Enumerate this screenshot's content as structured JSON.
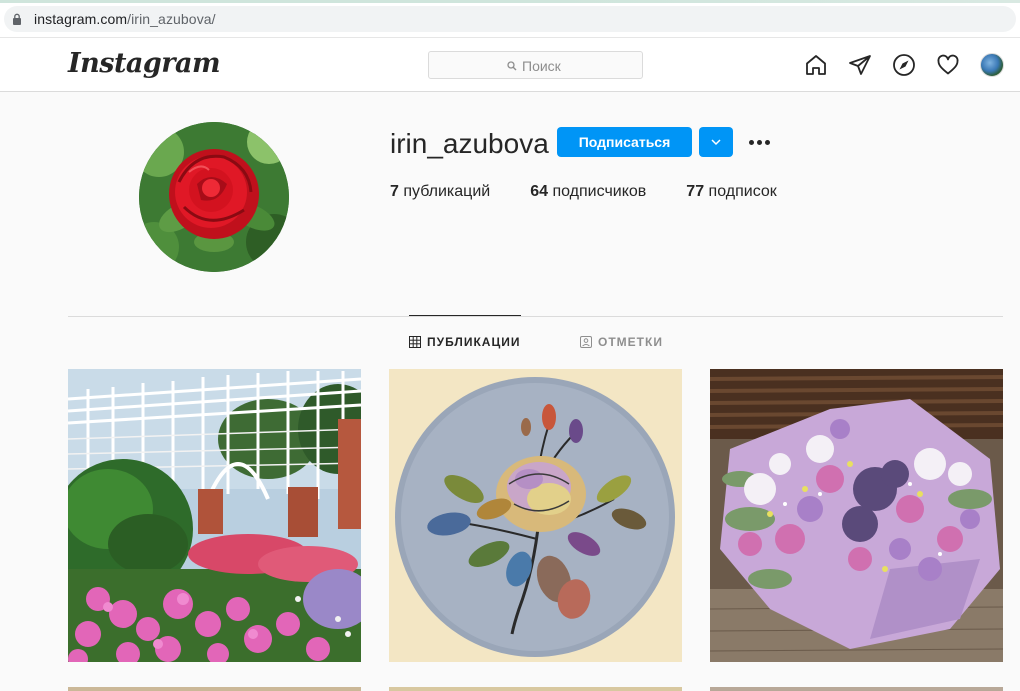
{
  "browser": {
    "url_host": "instagram.com",
    "url_path": "/irin_azubova/"
  },
  "nav": {
    "logo": "Instagram",
    "search_placeholder": "Поиск",
    "icons": [
      "home-icon",
      "direct-icon",
      "explore-icon",
      "activity-heart-icon",
      "profile-avatar"
    ]
  },
  "profile": {
    "username": "irin_azubova",
    "follow_label": "Подписаться",
    "stats": {
      "posts_count": "7",
      "posts_label": "публикаций",
      "followers_count": "64",
      "followers_label": "подписчиков",
      "following_count": "77",
      "following_label": "подписок"
    }
  },
  "tabs": [
    {
      "label": "ПУБЛИКАЦИИ",
      "active": true,
      "icon": "grid-icon"
    },
    {
      "label": "ОТМЕТКИ",
      "active": false,
      "icon": "tagged-icon"
    }
  ],
  "posts": [
    {
      "subject": "garden-pergola-flowers"
    },
    {
      "subject": "painted-rose-on-round-board"
    },
    {
      "subject": "purple-flower-bouquet"
    }
  ],
  "colors": {
    "accent": "#0095f6",
    "text": "#262626",
    "muted": "#8e8e8e",
    "border": "#dbdbdb",
    "background": "#fafafa"
  }
}
